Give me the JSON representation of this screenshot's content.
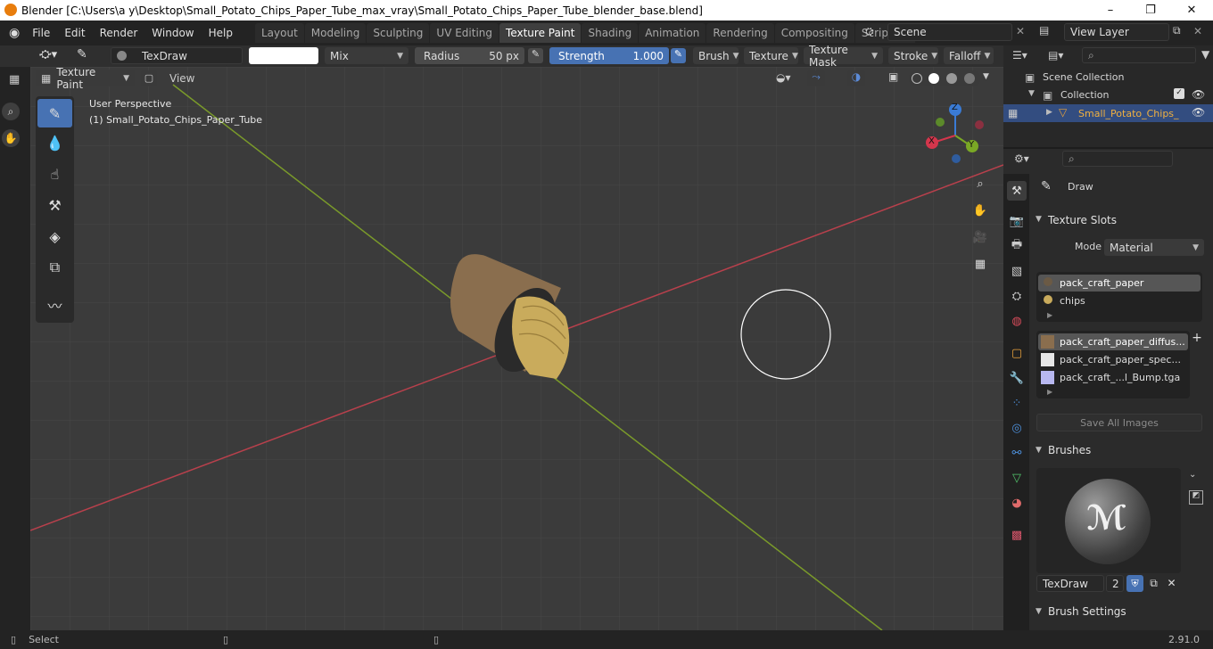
{
  "window": {
    "title": "Blender [C:\\Users\\a y\\Desktop\\Small_Potato_Chips_Paper_Tube_max_vray\\Small_Potato_Chips_Paper_Tube_blender_base.blend]",
    "minimize": "–",
    "maximize": "❐",
    "close": "✕"
  },
  "menu": [
    "File",
    "Edit",
    "Render",
    "Window",
    "Help"
  ],
  "workspaces": [
    "Layout",
    "Modeling",
    "Sculpting",
    "UV Editing",
    "Texture Paint",
    "Shading",
    "Animation",
    "Rendering",
    "Compositing",
    "Scripting"
  ],
  "workspace_add": "+",
  "scene": {
    "name": "Scene"
  },
  "view_layer": {
    "name": "View Layer"
  },
  "toolheader": {
    "brush_name": "TexDraw",
    "blend_mode": "Mix",
    "radius_label": "Radius",
    "radius_value": "50 px",
    "strength_label": "Strength",
    "strength_value": "1.000",
    "brush_menu": "Brush",
    "texture_menu": "Texture",
    "texture_mask_menu": "Texture Mask",
    "stroke_menu": "Stroke",
    "falloff_menu": "Falloff"
  },
  "viewport_header": {
    "mode": "Texture Paint",
    "view_menu": "View"
  },
  "viewport": {
    "perspective_label": "User Perspective",
    "object_label": "(1) Small_Potato_Chips_Paper_Tube",
    "gizmo": {
      "z": "Z",
      "y": "Y",
      "x": "X"
    }
  },
  "outliner": {
    "scene_collection": "Scene Collection",
    "collection": "Collection",
    "object": "Small_Potato_Chips_"
  },
  "properties": {
    "tool_name": "Draw",
    "texture_slots_title": "Texture Slots",
    "mode_label": "Mode",
    "mode_value": "Material",
    "materials": [
      "pack_craft_paper",
      "chips"
    ],
    "images": [
      "pack_craft_paper_diffus...",
      "pack_craft_paper_spec...",
      "pack_craft_...l_Bump.tga"
    ],
    "save_all_images": "Save All Images",
    "brushes_title": "Brushes",
    "brush_name": "TexDraw",
    "brush_users": "2",
    "brush_settings_title": "Brush Settings"
  },
  "statusbar": {
    "select": "Select",
    "version": "2.91.0"
  },
  "colors": {
    "accent": "#4772b3",
    "x_axis": "#b8404c",
    "y_axis": "#7a9a2a",
    "tube": "#8a6e4e",
    "chips": "#c9ab5c"
  }
}
